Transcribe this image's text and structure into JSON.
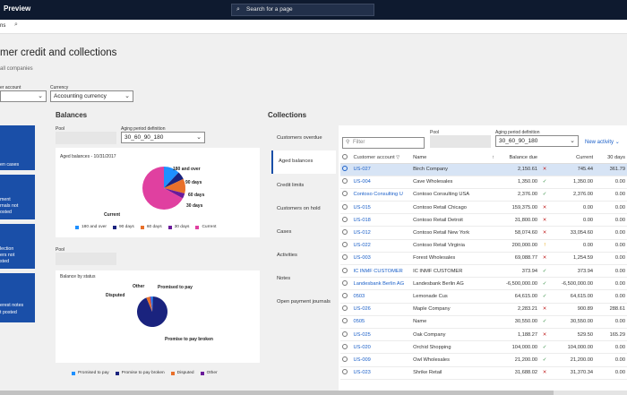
{
  "header": {
    "app_title": "Preview",
    "search_placeholder": "Search for a page",
    "search_icon": "search-icon"
  },
  "cmdbar": {
    "options_label": "ns",
    "search_icon": "search-icon"
  },
  "page": {
    "title": "mer credit and collections",
    "subtitle": "all companies"
  },
  "filters": {
    "customer_account_label": "er account",
    "currency_label": "Currency",
    "currency_value": "Accounting currency"
  },
  "tiles": [
    {
      "lines": [
        "en cases"
      ]
    },
    {
      "lines": [
        "ment",
        "rnals not",
        "osted"
      ]
    },
    {
      "lines": [
        "lection",
        "ers not",
        "sted"
      ]
    },
    {
      "lines": [
        "erest notes",
        "t posted"
      ]
    }
  ],
  "balances": {
    "title": "Balances",
    "pool_label": "Pool",
    "aging_label": "Aging period definition",
    "aging_value": "30_60_90_180",
    "pool2_label": "Pool"
  },
  "aged_chart": {
    "title": "Aged balances - 10/31/2017",
    "chart_data": {
      "type": "pie",
      "title": "Aged balances - 10/31/2017",
      "slices": [
        {
          "label": "180 and over",
          "value": 12,
          "color": "#1e90ff"
        },
        {
          "label": "90 days",
          "value": 6,
          "color": "#1a237e"
        },
        {
          "label": "60 days",
          "value": 11,
          "color": "#e8702a"
        },
        {
          "label": "30 days",
          "value": 4,
          "color": "#6a1b9a"
        },
        {
          "label": "Current",
          "value": 67,
          "color": "#e040a0"
        }
      ],
      "legend": [
        "180 and over",
        "90 days",
        "60 days",
        "30 days",
        "Current"
      ],
      "legend_placement": "bottom"
    }
  },
  "status_chart": {
    "title": "Balance by status",
    "chart_data": {
      "type": "pie",
      "title": "Balance by status",
      "slices": [
        {
          "label": "Promised to pay",
          "value": 2,
          "color": "#1e90ff"
        },
        {
          "label": "Promise to pay broken",
          "value": 93,
          "color": "#1a237e"
        },
        {
          "label": "Disputed",
          "value": 4,
          "color": "#e8702a"
        },
        {
          "label": "Other",
          "value": 1,
          "color": "#6a1b9a"
        }
      ],
      "legend": [
        "Promised to pay",
        "Promise to pay broken",
        "Disputed",
        "Other"
      ],
      "legend_placement": "bottom"
    }
  },
  "collections": {
    "title": "Collections",
    "nav": [
      "Customers overdue",
      "Aged balances",
      "Credit limits",
      "Customers on hold",
      "Cases",
      "Activities",
      "Notes",
      "Open payment journals"
    ],
    "active_index": 1,
    "pool_label": "Pool",
    "aging_label": "Aging period definition",
    "aging_value": "30_60_90_180",
    "filter_placeholder": "Filter",
    "new_activity": "New activity",
    "columns": {
      "account": "Customer account",
      "name": "Name",
      "sort": "↑",
      "balance": "Balance due",
      "current": "Current",
      "days30": "30 days"
    },
    "rows": [
      {
        "account": "US-027",
        "name": "Birch Company",
        "balance": "2,150.61",
        "status": "x",
        "current": "745.44",
        "d30": "361.79",
        "selected": true
      },
      {
        "account": "US-004",
        "name": "Cave Wholesales",
        "balance": "1,350.00",
        "status": "ok",
        "current": "1,350.00",
        "d30": "0.00"
      },
      {
        "account": "Contoso Consulting U",
        "name": "Contoso Consulting USA",
        "balance": "2,376.00",
        "status": "ok",
        "current": "2,376.00",
        "d30": "0.00"
      },
      {
        "account": "US-015",
        "name": "Contoso Retail Chicago",
        "balance": "159,375.00",
        "status": "x",
        "current": "0.00",
        "d30": "0.00"
      },
      {
        "account": "US-018",
        "name": "Contoso Retail Detroit",
        "balance": "31,800.00",
        "status": "x",
        "current": "0.00",
        "d30": "0.00"
      },
      {
        "account": "US-012",
        "name": "Contoso Retail New York",
        "balance": "58,074.60",
        "status": "x",
        "current": "33,054.60",
        "d30": "0.00"
      },
      {
        "account": "US-022",
        "name": "Contoso Retail Virginia",
        "balance": "200,000.00",
        "status": "warn",
        "current": "0.00",
        "d30": "0.00"
      },
      {
        "account": "US-003",
        "name": "Forest Wholesales",
        "balance": "69,088.77",
        "status": "x",
        "current": "1,254.59",
        "d30": "0.00"
      },
      {
        "account": "IC INMF CUSTOMER",
        "name": "IC INMF CUSTOMER",
        "balance": "373.94",
        "status": "ok",
        "current": "373.94",
        "d30": "0.00"
      },
      {
        "account": "Landesbank Berlin AG",
        "name": "Landesbank Berlin AG",
        "balance": "-6,500,000.00",
        "status": "ok",
        "current": "-6,500,000.00",
        "d30": "0.00"
      },
      {
        "account": "0503",
        "name": "Lemonade Cus",
        "balance": "64,615.00",
        "status": "ok",
        "current": "64,615.00",
        "d30": "0.00"
      },
      {
        "account": "US-026",
        "name": "Maple Company",
        "balance": "2,283.21",
        "status": "x",
        "current": "900.89",
        "d30": "288.61"
      },
      {
        "account": "0505",
        "name": "Name",
        "balance": "30,550.00",
        "status": "ok",
        "current": "30,550.00",
        "d30": "0.00"
      },
      {
        "account": "US-025",
        "name": "Oak Company",
        "balance": "1,188.27",
        "status": "x",
        "current": "529.50",
        "d30": "165.29"
      },
      {
        "account": "US-020",
        "name": "Orchid Shopping",
        "balance": "104,000.00",
        "status": "ok",
        "current": "104,000.00",
        "d30": "0.00"
      },
      {
        "account": "US-009",
        "name": "Owl Wholesales",
        "balance": "21,200.00",
        "status": "ok",
        "current": "21,200.00",
        "d30": "0.00"
      },
      {
        "account": "US-023",
        "name": "Shrike Retail",
        "balance": "31,688.02",
        "status": "x",
        "current": "31,370.34",
        "d30": "0.00"
      }
    ]
  }
}
